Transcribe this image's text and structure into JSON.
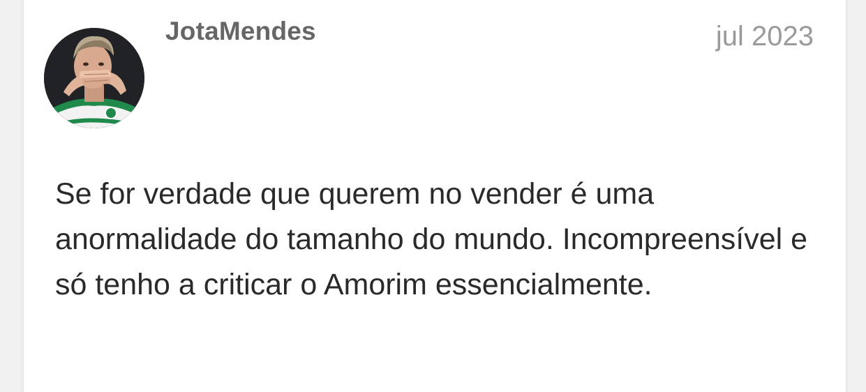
{
  "post": {
    "author": "JotaMendes",
    "date": "jul 2023",
    "avatar_icon": "user-avatar-photo",
    "body": "Se for verdade que querem no vender é uma anormalidade do tamanho do mundo. Incompreensível e só tenho a criticar o Amorim essencialmente."
  },
  "colors": {
    "author": "#666666",
    "date": "#9a9a9a",
    "body_text": "#2a2a2a",
    "card_background": "#ffffff",
    "page_background": "#f1f1f1",
    "jersey_green": "#1f8a4c"
  }
}
